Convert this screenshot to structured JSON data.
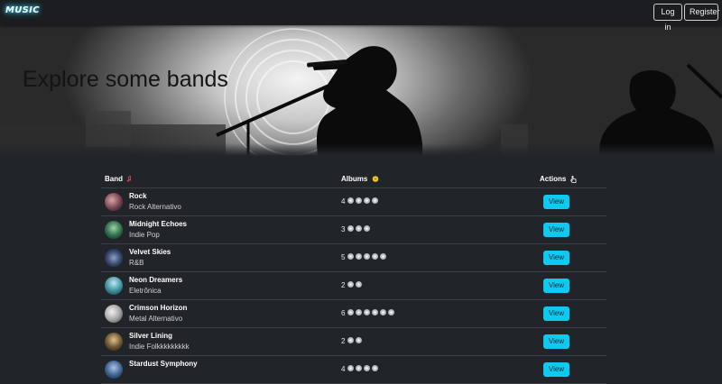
{
  "app": {
    "logo": "MUSIC"
  },
  "nav": {
    "login_label": "Log in",
    "register_label": "Register"
  },
  "hero": {
    "title": "Explore some bands"
  },
  "table": {
    "columns": {
      "band": "Band",
      "albums": "Albums",
      "actions": "Actions"
    },
    "view_label": "View",
    "rows": [
      {
        "name": "Rock",
        "genre": "Rock Alternativo",
        "albums": "4",
        "album_count": 4
      },
      {
        "name": "Midnight Echoes",
        "genre": "Indie Pop",
        "albums": "3",
        "album_count": 3
      },
      {
        "name": "Velvet Skies",
        "genre": "R&B",
        "albums": "5",
        "album_count": 5
      },
      {
        "name": "Neon Dreamers",
        "genre": "Eletrônica",
        "albums": "2",
        "album_count": 2
      },
      {
        "name": "Crimson Horizon",
        "genre": "Metal Alternativo",
        "albums": "6",
        "album_count": 6
      },
      {
        "name": "Silver Lining",
        "genre": "Indie Folkkkkkkkkk",
        "albums": "2",
        "album_count": 2
      },
      {
        "name": "Stardust Symphony",
        "genre": "",
        "albums": "4",
        "album_count": 4
      }
    ]
  },
  "colors": {
    "accent": "#0dcaf0",
    "logo_glow": "#2fd1ff",
    "background": "#212529"
  },
  "icons": {
    "band_header": "music-note-icon",
    "albums_header": "disc-icon",
    "actions_header": "hand-pointer-icon",
    "album_item": "disc-icon"
  }
}
